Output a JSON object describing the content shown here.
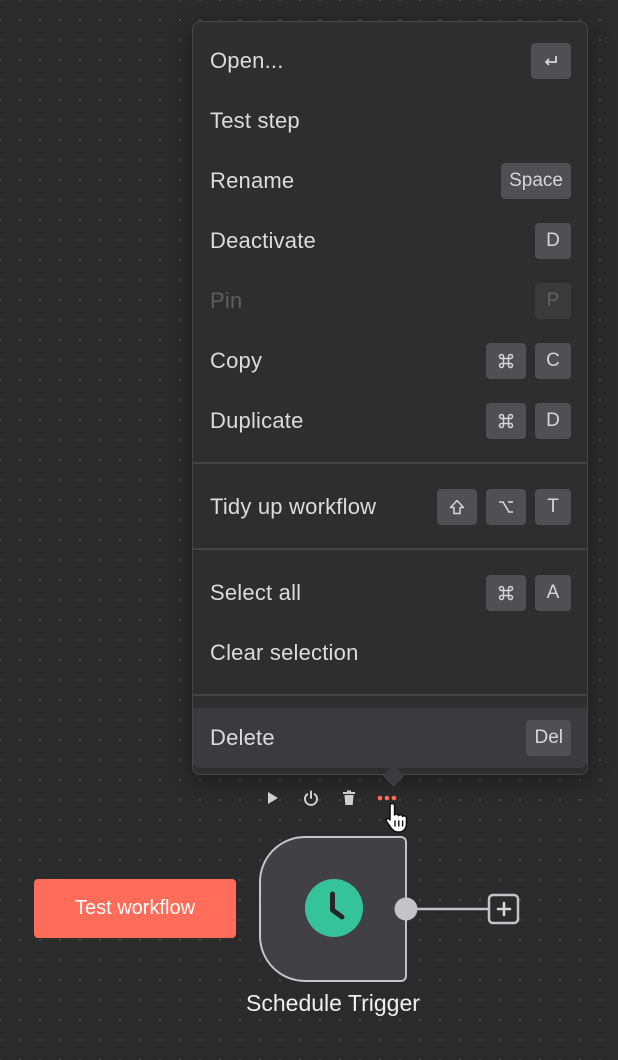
{
  "context_menu": {
    "items": [
      {
        "label": "Open...",
        "keys": [
          "enter-icon"
        ],
        "disabled": false,
        "active": false
      },
      {
        "label": "Test step",
        "keys": [],
        "disabled": false,
        "active": false
      },
      {
        "label": "Rename",
        "keys": [
          "Space"
        ],
        "disabled": false,
        "active": false
      },
      {
        "label": "Deactivate",
        "keys": [
          "D"
        ],
        "disabled": false,
        "active": false
      },
      {
        "label": "Pin",
        "keys": [
          "P"
        ],
        "disabled": true,
        "active": false
      },
      {
        "label": "Copy",
        "keys": [
          "command-icon",
          "C"
        ],
        "disabled": false,
        "active": false
      },
      {
        "label": "Duplicate",
        "keys": [
          "command-icon",
          "D"
        ],
        "disabled": false,
        "active": false
      },
      {
        "label": "Tidy up workflow",
        "keys": [
          "shift-icon",
          "option-icon",
          "T"
        ],
        "disabled": false,
        "active": false
      },
      {
        "label": "Select all",
        "keys": [
          "command-icon",
          "A"
        ],
        "disabled": false,
        "active": false
      },
      {
        "label": "Clear selection",
        "keys": [],
        "disabled": false,
        "active": false
      },
      {
        "label": "Delete",
        "keys": [
          "Del"
        ],
        "disabled": false,
        "active": true
      }
    ]
  },
  "node_toolbar": {
    "icons": [
      "play-icon",
      "power-icon",
      "trash-icon",
      "more-dots-icon"
    ],
    "more_color": "#ff6d5a"
  },
  "test_button": {
    "label": "Test workflow",
    "color": "#ff6d5a"
  },
  "node": {
    "label": "Schedule Trigger",
    "icon": "clock-icon",
    "icon_color": "#35c49a"
  },
  "colors": {
    "canvas": "#2b2b2b",
    "menu": "#2e2e2f",
    "accent": "#ff6d5a"
  }
}
